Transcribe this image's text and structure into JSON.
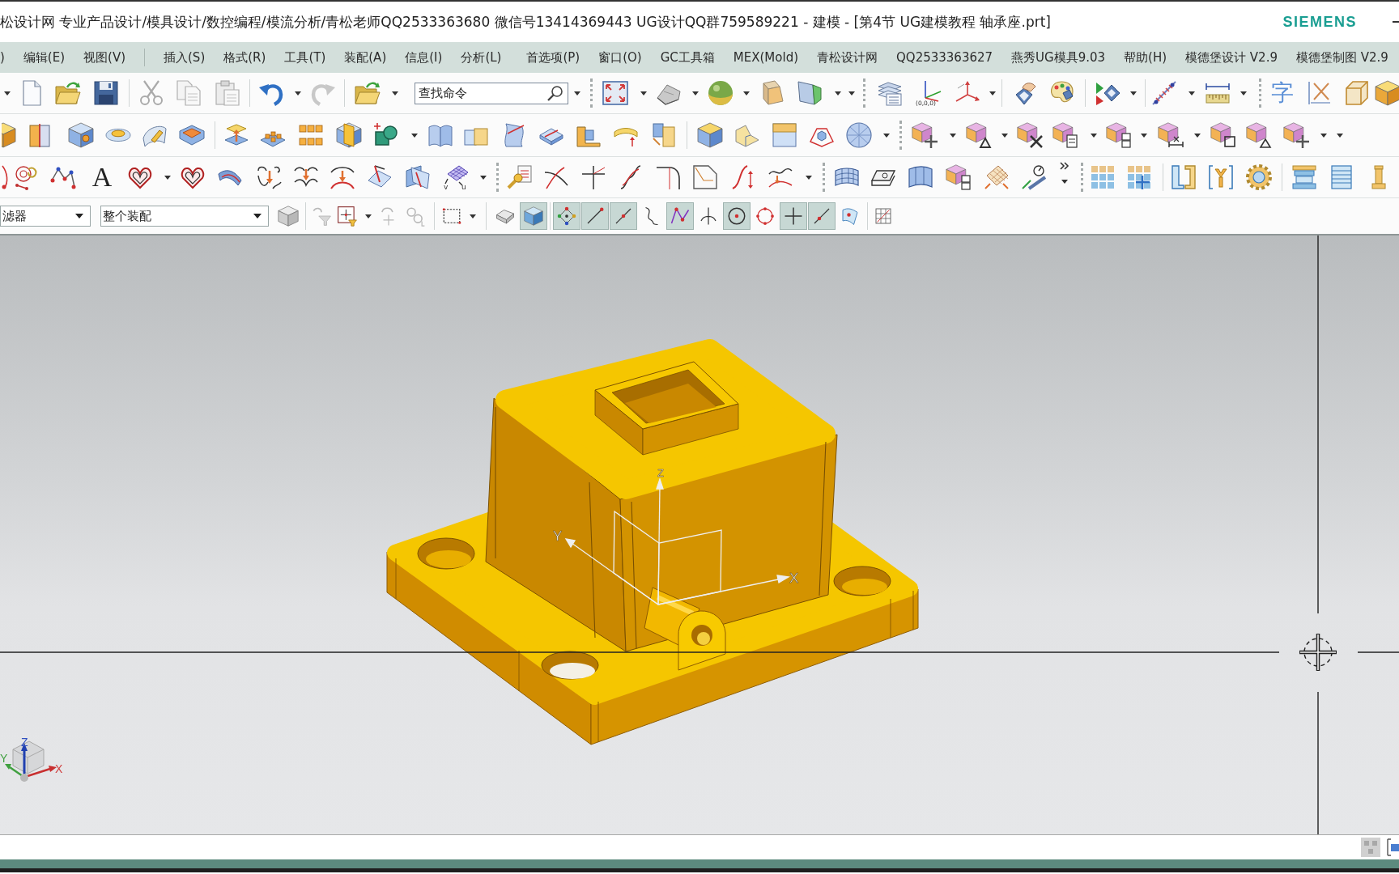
{
  "window": {
    "title": "松设计网 专业产品设计/模具设计/数控编程/模流分析/青松老师QQ2533363680 微信号13414369443 UG设计QQ群759589221 - 建模 - [第4节 UG建模教程 轴承座.prt]",
    "brand": "SIEMENS"
  },
  "menu": [
    ")",
    "编辑(E)",
    "视图(V)",
    "插入(S)",
    "格式(R)",
    "工具(T)",
    "装配(A)",
    "信息(I)",
    "分析(L)",
    "首选项(P)",
    "窗口(O)",
    "GC工具箱",
    "MEX(Mold)",
    "青松设计网",
    "QQ2533363627",
    "燕秀UG模具9.03",
    "帮助(H)",
    "模德堡设计 V2.9",
    "模德堡制图 V2.9"
  ],
  "toolbars": {
    "search": {
      "placeholder": "查找命令"
    },
    "icon_labels": {
      "origin": "(0,0,0)",
      "text_tool": "A",
      "character": "字",
      "grid_v": "v",
      "grid_u": "u"
    }
  },
  "selection_bar": {
    "type_filter": "滤器",
    "scope": "整个装配",
    "toggle_buttons": [
      {
        "selected": false
      },
      {
        "selected": true
      },
      {
        "selected": true
      },
      {
        "selected": true
      },
      {
        "selected": true
      },
      {
        "selected": false
      },
      {
        "selected": true
      },
      {
        "selected": false
      },
      {
        "selected": true
      },
      {
        "selected": false
      },
      {
        "selected": true
      },
      {
        "selected": true
      },
      {
        "selected": false
      }
    ]
  },
  "viewport": {
    "wcs_labels": {
      "x": "X",
      "y": "Y",
      "z": "Z"
    },
    "view_triad_labels": {
      "x": "X",
      "y": "Y",
      "z": "Z"
    }
  }
}
